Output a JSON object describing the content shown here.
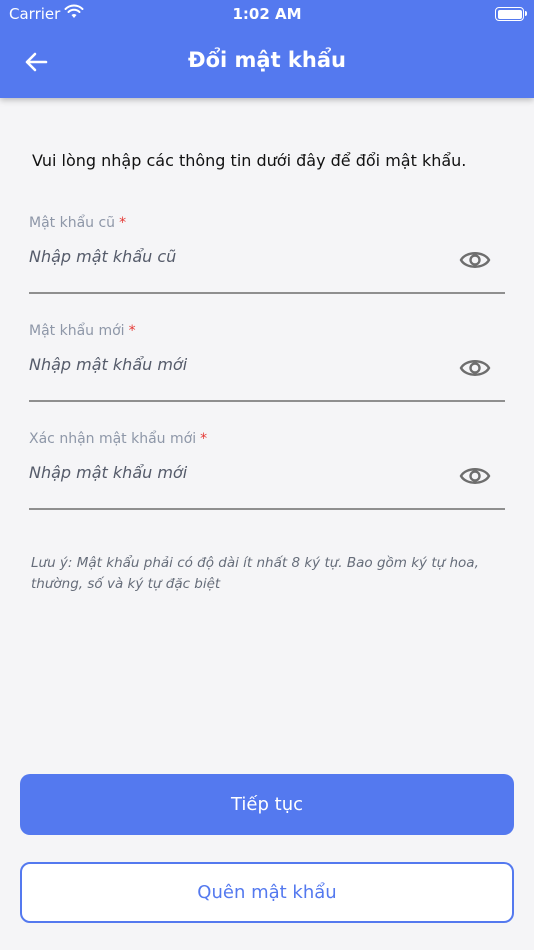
{
  "status_bar": {
    "carrier": "Carrier",
    "time": "1:02 AM",
    "icons": [
      "wifi-icon",
      "battery-icon"
    ]
  },
  "header": {
    "title": "Đổi mật khẩu",
    "back_icon": "arrow-left-icon",
    "background_color": "#5479ef"
  },
  "intro_text": "Vui lòng nhập các thông tin dưới đây để đổi mật khẩu.",
  "fields": [
    {
      "label": "Mật khẩu cũ",
      "required_mark": "*",
      "placeholder": "Nhập mật khẩu cũ",
      "value": "",
      "icon": "eye-icon"
    },
    {
      "label": "Mật khẩu mới",
      "required_mark": "*",
      "placeholder": "Nhập mật khẩu mới",
      "value": "",
      "icon": "eye-icon"
    },
    {
      "label": "Xác nhận mật khẩu mới",
      "required_mark": "*",
      "placeholder": "Nhập mật khẩu mới",
      "value": "",
      "icon": "eye-icon"
    }
  ],
  "note": "Lưu ý: Mật khẩu phải có độ dài ít nhất 8 ký tự. Bao gồm ký tự hoa, thường, số và ký tự đặc biệt",
  "buttons": {
    "continue_label": "Tiếp tục",
    "forgot_label": "Quên mật khẩu"
  },
  "colors": {
    "accent": "#5479ef",
    "required": "#e53935"
  }
}
